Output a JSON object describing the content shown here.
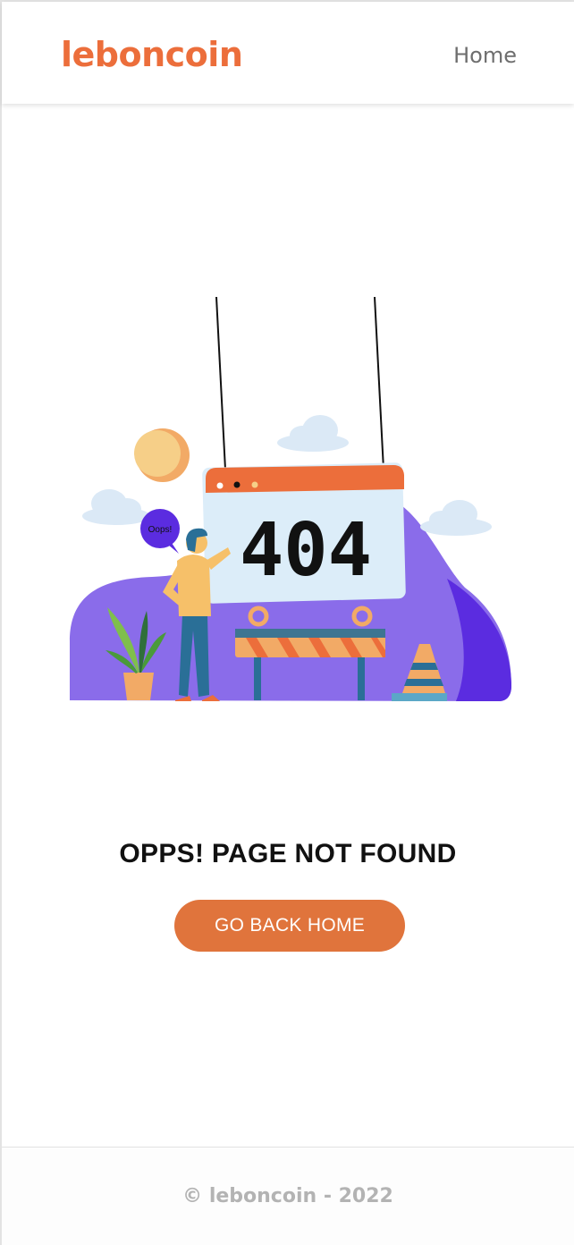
{
  "header": {
    "logo_text": "leboncoin",
    "nav_home": "Home"
  },
  "illustration": {
    "sign_text": "404",
    "speech_text": "Oops!"
  },
  "main": {
    "title": "OPPS! PAGE NOT FOUND",
    "button_label": "GO BACK HOME"
  },
  "footer": {
    "copyright": "© leboncoin - 2022"
  },
  "colors": {
    "brand": "#ec6e3b",
    "button": "#e0743c",
    "blob": "#8a6cea",
    "blob_dark": "#5b2ce0"
  }
}
